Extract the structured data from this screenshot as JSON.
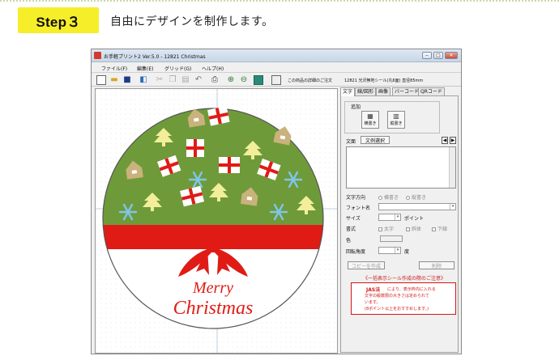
{
  "step": {
    "badge": "Step３",
    "description": "自由にデザインを制作します。"
  },
  "window": {
    "title": "お手軽プリント2  Ver.5.0 - 12821 Christmas",
    "buttons": [
      "‒",
      "□",
      "✕"
    ]
  },
  "menu": [
    {
      "label": "ファイル(F)"
    },
    {
      "label": "編集(E)"
    },
    {
      "label": "グリッド(G)"
    },
    {
      "label": "ヘルプ(H)"
    }
  ],
  "toolbar": {
    "info_label": "この商品の詳細のご注文",
    "product_info": "12821 光沢無地シール(丸6面) 直径85mm"
  },
  "tabs": [
    {
      "label": "文字"
    },
    {
      "label": "線/図形"
    },
    {
      "label": "画像"
    },
    {
      "label": "バーコード"
    },
    {
      "label": "QRコード"
    }
  ],
  "panel": {
    "add_group_label": "追加",
    "horizontal_button": "横書き",
    "vertical_button": "縦書き",
    "text_label": "文面",
    "sample_button": "文例選択",
    "prev_arrow": "◀",
    "next_arrow": "▶",
    "direction_label": "文字方向",
    "direction_h": "横書き",
    "direction_v": "縦書き",
    "font_label": "フォント名",
    "size_label": "サイズ",
    "size_unit": "ポイント",
    "style_label": "書式",
    "style_bold": "太字",
    "style_italic": "斜体",
    "style_underline": "下線",
    "color_label": "色",
    "rotation_label": "回転角度",
    "rotation_unit": "度",
    "copy_button": "コピーを作成",
    "delete_button": "削除",
    "notice_title": "《一括表示シール作成の際のご注意》",
    "notice_heading": "JAS法",
    "notice_line1": "により、表示枠内に入れる",
    "notice_line2": "文字の級数限の大きさは定められて",
    "notice_line3": "います。",
    "notice_line4": "(8ポイント以上をおすすめします。)"
  },
  "design": {
    "text_line1": "Merry",
    "text_line2": "Christmas",
    "colors": {
      "green": "#6f9a3a",
      "red": "#e01b16",
      "cream": "#f3ee9a",
      "house": "#c9b27c",
      "snow": "#7fc6e8"
    }
  }
}
